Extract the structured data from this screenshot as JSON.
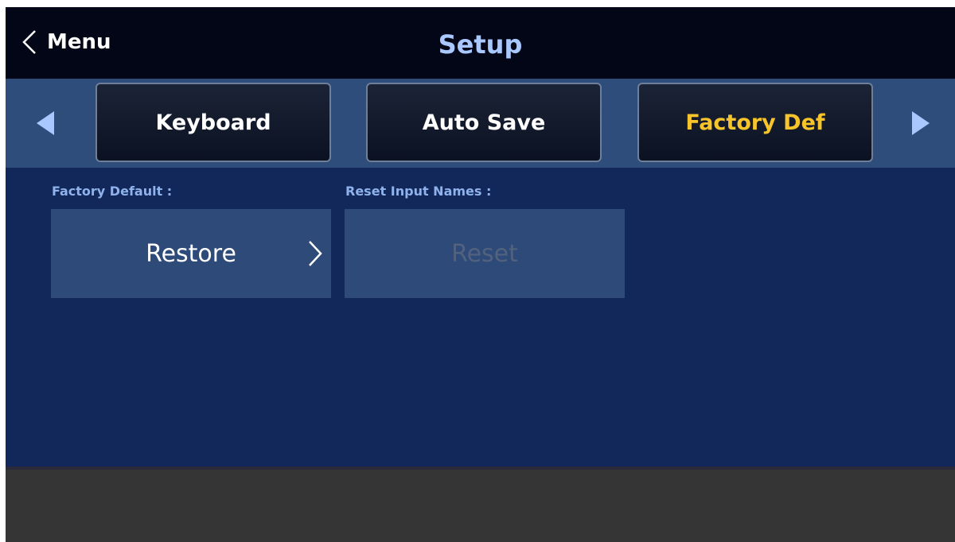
{
  "header": {
    "back_label": "Menu",
    "title": "Setup"
  },
  "tabs": [
    {
      "label": "Keyboard",
      "active": false
    },
    {
      "label": "Auto Save",
      "active": false
    },
    {
      "label": "Factory Def",
      "active": true
    }
  ],
  "content": {
    "factory_default_label": "Factory Default :",
    "restore_label": "Restore",
    "reset_input_names_label": "Reset Input Names :",
    "reset_label": "Reset"
  },
  "colors": {
    "active_tab_text": "#f7c52b",
    "title_text": "#a8c8ff",
    "background": "#12285a"
  },
  "icons": {
    "back": "chevron-left-icon",
    "tab_prev": "triangle-left-icon",
    "tab_next": "triangle-right-icon",
    "restore_go": "chevron-right-icon"
  }
}
